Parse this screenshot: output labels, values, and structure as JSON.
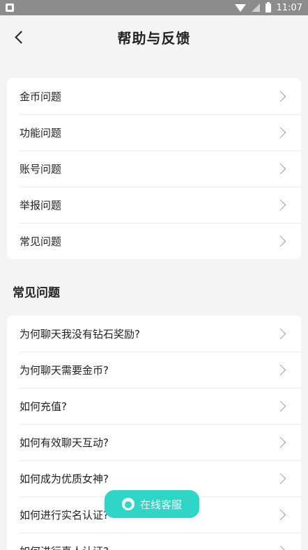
{
  "status_bar": {
    "time": "11:07"
  },
  "nav": {
    "title": "帮助与反馈"
  },
  "categories": [
    {
      "label": "金币问题"
    },
    {
      "label": "功能问题"
    },
    {
      "label": "账号问题"
    },
    {
      "label": "举报问题"
    },
    {
      "label": "常见问题"
    }
  ],
  "faq_section": {
    "heading": "常见问题"
  },
  "faq": [
    {
      "label": "为何聊天我没有钻石奖励?"
    },
    {
      "label": "为何聊天需要金币?"
    },
    {
      "label": "如何充值?"
    },
    {
      "label": "如何有效聊天互动?"
    },
    {
      "label": "如何成为优质女神?"
    },
    {
      "label": "如何进行实名认证?"
    },
    {
      "label": "如何进行真人认证?"
    }
  ],
  "fab": {
    "label": "在线客服"
  },
  "colors": {
    "accent": "#2ed6c8",
    "background": "#f4f4f4",
    "status_bar": "#8c8c8c"
  }
}
